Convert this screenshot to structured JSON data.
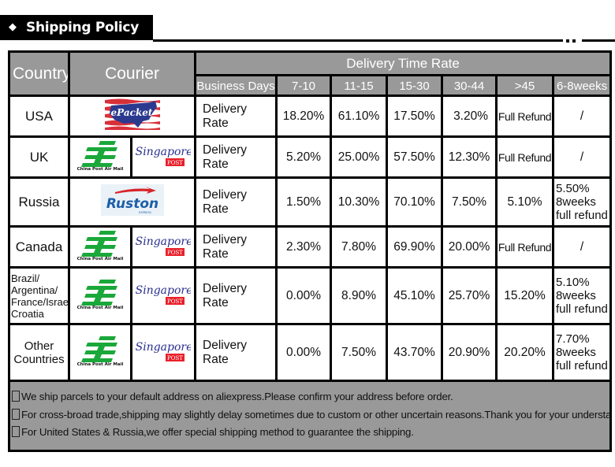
{
  "header": {
    "title": "Shipping Policy",
    "title_icon": "diamond-icon"
  },
  "table": {
    "headers": {
      "country": "Country",
      "courier": "Courier",
      "delivery_time_rate": "Delivery Time Rate",
      "business_days": "Business Days",
      "ranges": [
        "7-10",
        "11-15",
        "15-30",
        "30-44",
        ">45",
        "6-8weeks"
      ]
    },
    "rows": [
      {
        "country": "USA",
        "couriers": [
          "ePacket"
        ],
        "label": "Delivery Rate",
        "values": [
          "18.20%",
          "61.10%",
          "17.50%",
          "3.20%",
          "Full Refund",
          "/"
        ]
      },
      {
        "country": "UK",
        "couriers": [
          "China Post Air Mail",
          "Singapore Post"
        ],
        "label": "Delivery Rate",
        "values": [
          "5.20%",
          "25.00%",
          "57.50%",
          "12.30%",
          "Full Refund",
          "/"
        ]
      },
      {
        "country": "Russia",
        "couriers": [
          "Ruston Express"
        ],
        "label": "Delivery Rate",
        "values": [
          "1.50%",
          "10.30%",
          "70.10%",
          "7.50%",
          "5.10%",
          "5.50%\n8weeks\nfull refund"
        ],
        "last": [
          "5.50%",
          "8weeks",
          "full refund"
        ]
      },
      {
        "country": "Canada",
        "couriers": [
          "China Post Air Mail",
          "Singapore Post"
        ],
        "label": "Delivery Rate",
        "values": [
          "2.30%",
          "7.80%",
          "69.90%",
          "20.00%",
          "Full Refund",
          "/"
        ]
      },
      {
        "country_lines": [
          "Brazil/",
          "Argentina/",
          "France/Israel/",
          "Croatia"
        ],
        "couriers": [
          "China Post Air Mail",
          "Singapore Post"
        ],
        "label": "Delivery Rate",
        "values": [
          "0.00%",
          "8.90%",
          "45.10%",
          "25.70%",
          "15.20%",
          "5.10%\n8weeks\nfull refund"
        ],
        "last": [
          "5.10%",
          "8weeks",
          "full refund"
        ]
      },
      {
        "country_lines": [
          "Other",
          "Countries"
        ],
        "couriers": [
          "China Post Air Mail",
          "Singapore Post"
        ],
        "label": "Delivery Rate",
        "values": [
          "0.00%",
          "7.50%",
          "43.70%",
          "20.90%",
          "20.20%",
          "7.70%\n8weeks\nfull refund"
        ],
        "last": [
          "7.70%",
          "8weeks",
          "full refund"
        ]
      }
    ]
  },
  "logos": {
    "epacket": "ePacket",
    "china_post": "China Post Air Mail",
    "singapore": "Singapore",
    "post": "POST",
    "ruston": "Ruston",
    "express": "EXPRESS"
  },
  "notes": [
    "We ship parcels to your default address on aliexpress.Please confirm your address before order.",
    "For cross-broad trade,shipping may slightly delay sometimes due to custom or other uncertain reasons.Thank you for your understanding.",
    "For United States & Russia,we offer special shipping method to guarantee the shipping."
  ],
  "colors": {
    "header_bg": "#999999",
    "china_post_green": "#1aa83a",
    "singapore_blue": "#2a2f8f",
    "post_red": "#e8202a",
    "ruston_blue": "#1c5fa8",
    "ruston_red": "#d8252a"
  }
}
